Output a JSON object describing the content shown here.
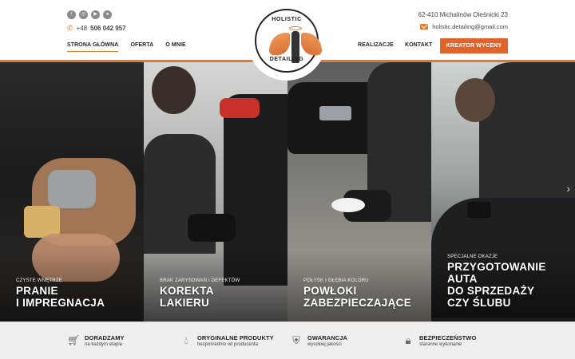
{
  "header": {
    "socials": [
      {
        "icon": "facebook-icon",
        "glyph": "f"
      },
      {
        "icon": "instagram-icon",
        "glyph": "◎"
      },
      {
        "icon": "youtube-icon",
        "glyph": "▶"
      },
      {
        "icon": "web-icon",
        "glyph": "●"
      }
    ],
    "phone_prefix": "+48",
    "phone_number": "506 042 957",
    "address": "62-410 Michalinów Oleśnicki 23",
    "email": "holistic.detailing@gmail.com",
    "cta_label": "KREATOR WYCENY",
    "nav_left": [
      {
        "label": "STRONA GŁÓWNA"
      },
      {
        "label": "OFERTA"
      },
      {
        "label": "O MNIE"
      }
    ],
    "nav_right": [
      {
        "label": "REALIZACJE"
      },
      {
        "label": "KONTAKT"
      }
    ],
    "logo": {
      "text_top": "HOLISTIC",
      "text_bottom": "DETAILING"
    }
  },
  "hero": {
    "panels": [
      {
        "subtitle": "CZYSTE WNĘTRZE",
        "title_line1": "PRANIE",
        "title_line2": "I IMPREGNACJA",
        "title_line3": ""
      },
      {
        "subtitle": "BRAK ZARYSOWAŃ I DEFEKTÓW",
        "title_line1": "KOREKTA",
        "title_line2": "LAKIERU",
        "title_line3": ""
      },
      {
        "subtitle": "POŁYSK I GŁĘBIA KOLORU",
        "title_line1": "POWŁOKI",
        "title_line2": "ZABEZPIECZAJĄCE",
        "title_line3": ""
      },
      {
        "subtitle": "SPECJALNE OKAZJE",
        "title_line1": "PRZYGOTOWANIE",
        "title_line2": "AUTA",
        "title_line3": "DO SPRZEDAŻY",
        "title_line4": "CZY ŚLUBU"
      }
    ]
  },
  "features": [
    {
      "icon": "cart-icon",
      "title": "DORADZAMY",
      "subtitle": "na każdym etapie"
    },
    {
      "icon": "drop-icon",
      "title": "ORYGINALNE PRODUKTY",
      "subtitle": "bezpośrednio od producenta"
    },
    {
      "icon": "shield-icon",
      "title": "GWARANCJA",
      "subtitle": "wysokiej jakości"
    },
    {
      "icon": "lock-icon",
      "title": "BEZPIECZEŃSTWO",
      "subtitle": "staranne wykonanie"
    }
  ]
}
